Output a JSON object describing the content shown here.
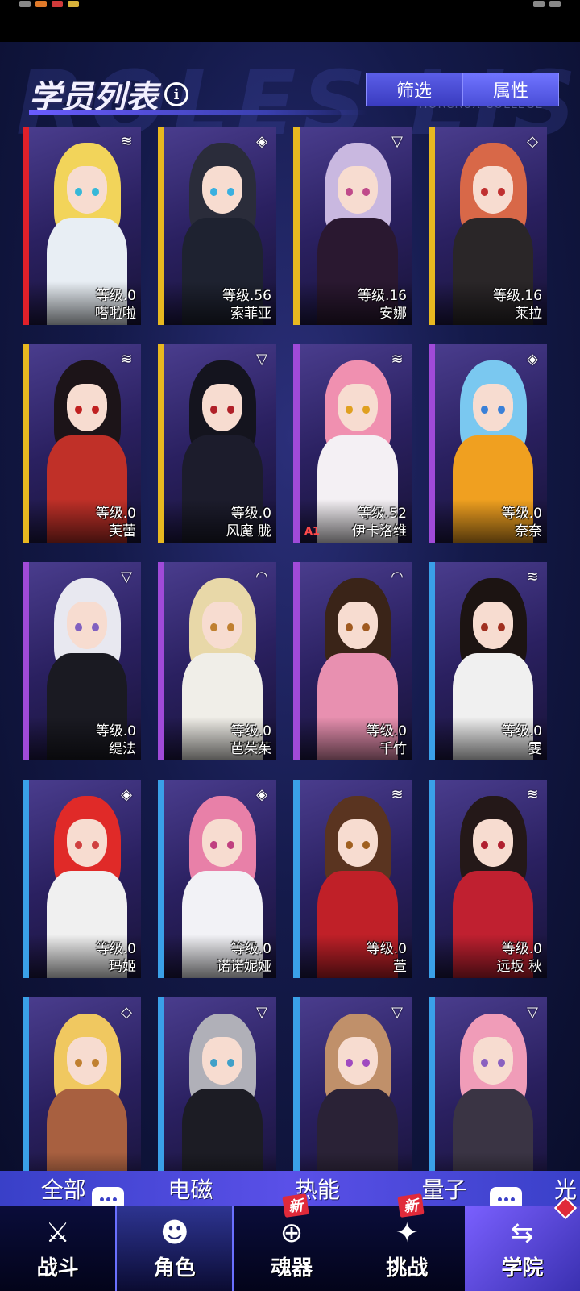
{
  "header": {
    "title": "学员列表",
    "info_icon": "i",
    "background_word": "ROLES LIST",
    "college_text": "HORCRUX COLLEGE",
    "filter_label": "筛选",
    "attribute_label": "属性"
  },
  "cards": [
    {
      "level": "等级.0",
      "name": "嗒啦啦",
      "rarity": "#e0202a",
      "hair": "#f2d45a",
      "eye": "#36b8d8",
      "outfit": "#e8eef4",
      "element": "wave-icon",
      "symbol": "≋"
    },
    {
      "level": "等级.56",
      "name": "索菲亚",
      "rarity": "#e8b820",
      "hair": "#2a2c3a",
      "eye": "#3ab0e0",
      "outfit": "#1e2230",
      "element": "drop-icon",
      "symbol": "◈"
    },
    {
      "level": "等级.16",
      "name": "安娜",
      "rarity": "#e8b820",
      "hair": "#c9b8e0",
      "eye": "#c04a8a",
      "outfit": "#2a1830",
      "element": "triangle-icon",
      "symbol": "▽"
    },
    {
      "level": "等级.16",
      "name": "莱拉",
      "rarity": "#e8b820",
      "hair": "#d86848",
      "eye": "#c03030",
      "outfit": "#2a2628",
      "element": "diamond-icon",
      "symbol": "◇"
    },
    {
      "level": "等级.0",
      "name": "芙蕾",
      "rarity": "#e8b820",
      "hair": "#1c1418",
      "eye": "#c02020",
      "outfit": "#c03028",
      "element": "wave-icon",
      "symbol": "≋"
    },
    {
      "level": "等级.0",
      "name": "风魔 胧",
      "rarity": "#e8b820",
      "hair": "#14141e",
      "eye": "#b02028",
      "outfit": "#1c1c2c",
      "element": "triangle-icon",
      "symbol": "▽"
    },
    {
      "level": "等级.52",
      "name": "伊卡洛维",
      "rarity": "#a04ad8",
      "hair": "#f090b0",
      "eye": "#e0a020",
      "outfit": "#f4f0f4",
      "element": "wave-icon",
      "symbol": "≋",
      "tag": "A1"
    },
    {
      "level": "等级.0",
      "name": "奈奈",
      "rarity": "#a04ad8",
      "hair": "#7ac8f0",
      "eye": "#3a80d8",
      "outfit": "#f0a020",
      "element": "drop-icon",
      "symbol": "◈"
    },
    {
      "level": "等级.0",
      "name": "缇法",
      "rarity": "#a04ad8",
      "hair": "#e8e8f0",
      "eye": "#8060c0",
      "outfit": "#1a1a22",
      "element": "triangle-icon",
      "symbol": "▽"
    },
    {
      "level": "等级.0",
      "name": "芭茱茱",
      "rarity": "#a04ad8",
      "hair": "#e8d8a8",
      "eye": "#c08030",
      "outfit": "#f0eee8",
      "element": "signal-icon",
      "symbol": "◠"
    },
    {
      "level": "等级.0",
      "name": "千竹",
      "rarity": "#a04ad8",
      "hair": "#3a2418",
      "eye": "#a05a20",
      "outfit": "#e890b0",
      "element": "signal-icon",
      "symbol": "◠"
    },
    {
      "level": "等级.0",
      "name": "雯",
      "rarity": "#3aa0e8",
      "hair": "#1c1412",
      "eye": "#a03020",
      "outfit": "#f0f0f0",
      "element": "wave-icon",
      "symbol": "≋"
    },
    {
      "level": "等级.0",
      "name": "玛姬",
      "rarity": "#3aa0e8",
      "hair": "#e02a28",
      "eye": "#d04040",
      "outfit": "#f0f0f0",
      "element": "drop-icon",
      "symbol": "◈"
    },
    {
      "level": "等级.0",
      "name": "诺诺妮娅",
      "rarity": "#3aa0e8",
      "hair": "#e880a8",
      "eye": "#c04080",
      "outfit": "#f2f2f6",
      "element": "drop-icon",
      "symbol": "◈"
    },
    {
      "level": "等级.0",
      "name": "萱",
      "rarity": "#3aa0e8",
      "hair": "#5a3420",
      "eye": "#a06020",
      "outfit": "#c02028",
      "element": "wave-icon",
      "symbol": "≋"
    },
    {
      "level": "等级.0",
      "name": "远坂 秋",
      "rarity": "#3aa0e8",
      "hair": "#241818",
      "eye": "#b02030",
      "outfit": "#c02030",
      "element": "wave-icon",
      "symbol": "≋"
    },
    {
      "level": "",
      "name": "",
      "rarity": "#3aa0e8",
      "hair": "#f0c860",
      "eye": "#c08030",
      "outfit": "#a86040",
      "element": "diamond-icon",
      "symbol": "◇"
    },
    {
      "level": "",
      "name": "",
      "rarity": "#3aa0e8",
      "hair": "#b0b0b8",
      "eye": "#40a0c8",
      "outfit": "#1c1c24",
      "element": "triangle-icon",
      "symbol": "▽"
    },
    {
      "level": "",
      "name": "",
      "rarity": "#3aa0e8",
      "hair": "#c0906a",
      "eye": "#a04ac0",
      "outfit": "#2a2236",
      "element": "triangle-icon",
      "symbol": "▽"
    },
    {
      "level": "",
      "name": "",
      "rarity": "#3aa0e8",
      "hair": "#f09cb8",
      "eye": "#8a60c0",
      "outfit": "#3a3444",
      "element": "triangle-icon",
      "symbol": "▽"
    }
  ],
  "element_tabs": [
    "全部",
    "电磁",
    "热能",
    "量子",
    "光"
  ],
  "bottom_nav": [
    {
      "label": "战斗",
      "icon": "battle-icon",
      "glyph": "⚔",
      "new": ""
    },
    {
      "label": "角色",
      "icon": "people-icon",
      "glyph": "☻",
      "new": ""
    },
    {
      "label": "魂器",
      "icon": "soul-icon",
      "glyph": "⊕",
      "new": "新"
    },
    {
      "label": "挑战",
      "icon": "challenge-icon",
      "glyph": "✦",
      "new": "新"
    },
    {
      "label": "学院",
      "icon": "academy-icon",
      "glyph": "⇆",
      "new": ""
    }
  ]
}
